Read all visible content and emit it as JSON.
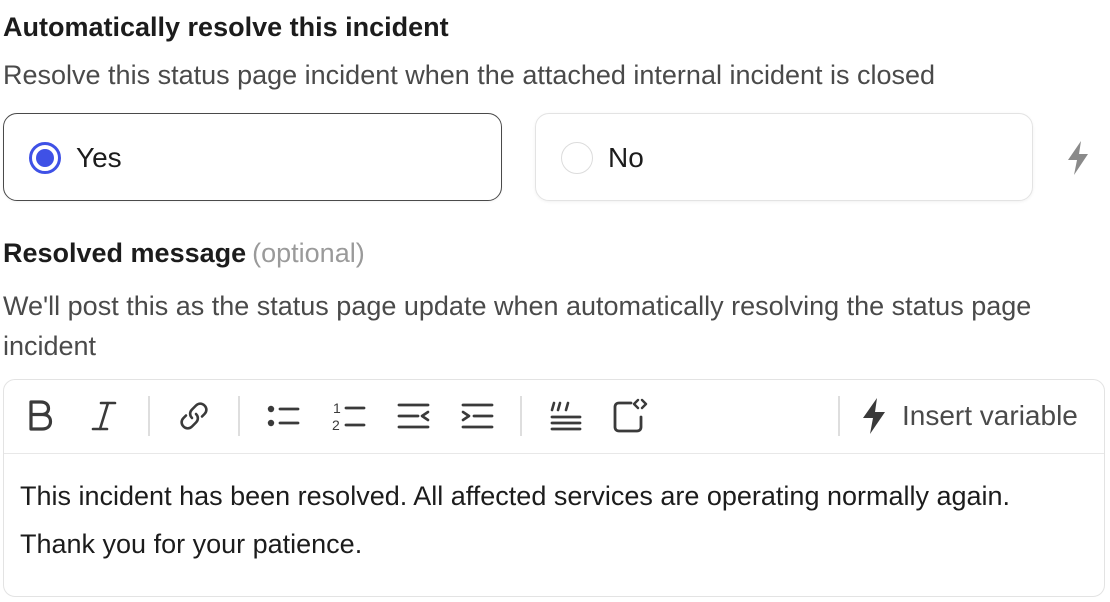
{
  "auto_resolve": {
    "title": "Automatically resolve this incident",
    "description": "Resolve this status page incident when the attached internal incident is closed",
    "options": [
      {
        "label": "Yes",
        "selected": true
      },
      {
        "label": "No",
        "selected": false
      }
    ]
  },
  "resolved_message": {
    "title": "Resolved message",
    "optional_label": "(optional)",
    "description": "We'll post this as the status page update when automatically resolving the status page incident",
    "toolbar": {
      "buttons": [
        "bold-icon",
        "italic-icon",
        "link-icon",
        "bullet-list-icon",
        "numbered-list-icon",
        "outdent-icon",
        "indent-icon",
        "quote-icon",
        "code-block-icon"
      ],
      "insert_variable_label": "Insert variable"
    },
    "content": "This incident has been resolved. All affected services are operating normally again. Thank you for your patience."
  },
  "colors": {
    "accent": "#3f51e6",
    "text": "#1c1c1c",
    "muted": "#4a4a4a",
    "optional": "#9a9a9a"
  }
}
